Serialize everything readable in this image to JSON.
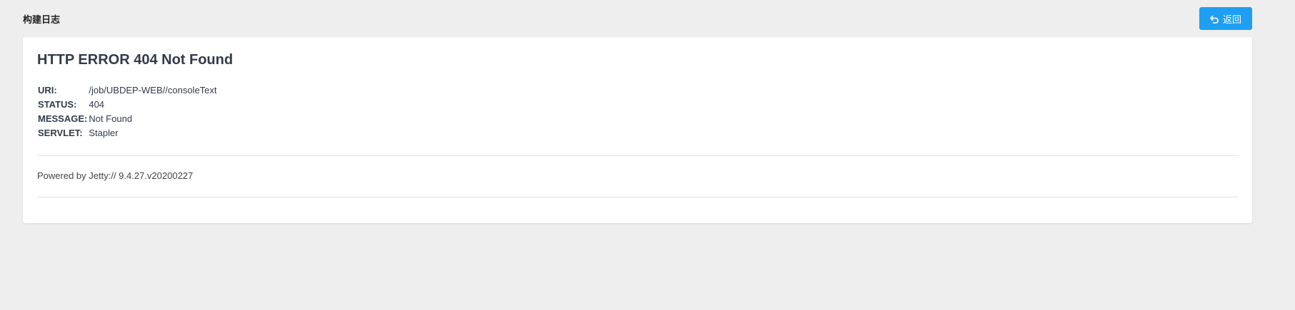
{
  "header": {
    "title": "构建日志",
    "back_label": "返回",
    "back_icon": "undo-icon",
    "accent_color": "#1e9ff2"
  },
  "error": {
    "title": "HTTP ERROR 404 Not Found",
    "fields": [
      {
        "label": "URI:",
        "value": "/job/UBDEP-WEB//consoleText"
      },
      {
        "label": "STATUS:",
        "value": "404"
      },
      {
        "label": "MESSAGE:",
        "value": "Not Found"
      },
      {
        "label": "SERVLET:",
        "value": "Stapler"
      }
    ],
    "footer": "Powered by Jetty:// 9.4.27.v20200227"
  }
}
